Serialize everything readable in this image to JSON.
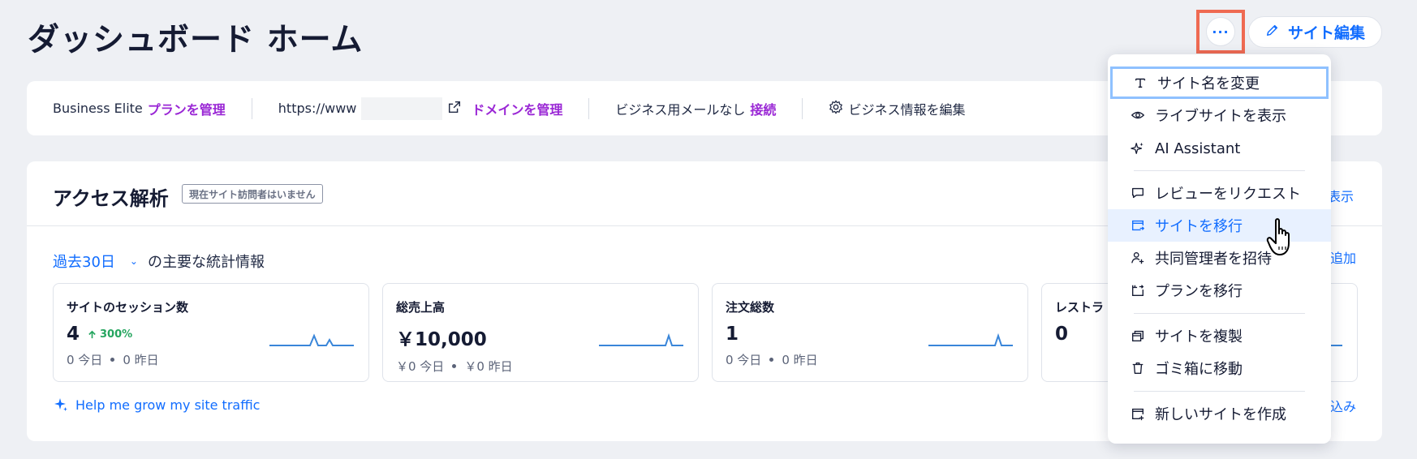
{
  "page": {
    "title": "ダッシュボード ホーム"
  },
  "header": {
    "more_label": "···",
    "edit_site_label": "サイト編集"
  },
  "info_bar": {
    "plan_name": "Business Elite",
    "plan_link": "プランを管理",
    "url_prefix": "https://www",
    "domain_link": "ドメインを管理",
    "email_text": "ビジネス用メールなし",
    "email_link": "接続",
    "business_info_label": "ビジネス情報を編集"
  },
  "analytics": {
    "title": "アクセス解析",
    "badge": "現在サイト訪問者はいません",
    "period_value": "過去30日",
    "period_suffix": "の主要な統計情報",
    "right_link_view": "表示",
    "right_link_add": "追加",
    "right_link_more": "込み",
    "help_link": "Help me grow my site traffic",
    "stats": [
      {
        "label": "サイトのセッション数",
        "value": "4",
        "trend": "300%",
        "today": "0 今日",
        "yesterday": "0 昨日"
      },
      {
        "label": "総売上高",
        "value": "￥10,000",
        "today": "￥0 今日",
        "yesterday": "￥0 昨日"
      },
      {
        "label": "注文総数",
        "value": "1",
        "today": "0 今日",
        "yesterday": "0 昨日"
      },
      {
        "label": "レストラ",
        "value": "0"
      }
    ]
  },
  "menu": {
    "items": [
      {
        "label": "サイト名を変更",
        "icon": "text-icon"
      },
      {
        "label": "ライブサイトを表示",
        "icon": "eye-icon"
      },
      {
        "label": "AI Assistant",
        "icon": "sparkle-icon"
      },
      {
        "label": "レビューをリクエスト",
        "icon": "chat-icon"
      },
      {
        "label": "サイトを移行",
        "icon": "transfer-site-icon"
      },
      {
        "label": "共同管理者を招待",
        "icon": "invite-user-icon"
      },
      {
        "label": "プランを移行",
        "icon": "transfer-plan-icon"
      },
      {
        "label": "サイトを複製",
        "icon": "duplicate-icon"
      },
      {
        "label": "ゴミ箱に移動",
        "icon": "trash-icon"
      },
      {
        "label": "新しいサイトを作成",
        "icon": "new-site-icon"
      }
    ]
  },
  "colors": {
    "accent": "#116dff",
    "purple": "#9a27d5",
    "highlight": "#ef6a52",
    "positive": "#25a55f"
  }
}
